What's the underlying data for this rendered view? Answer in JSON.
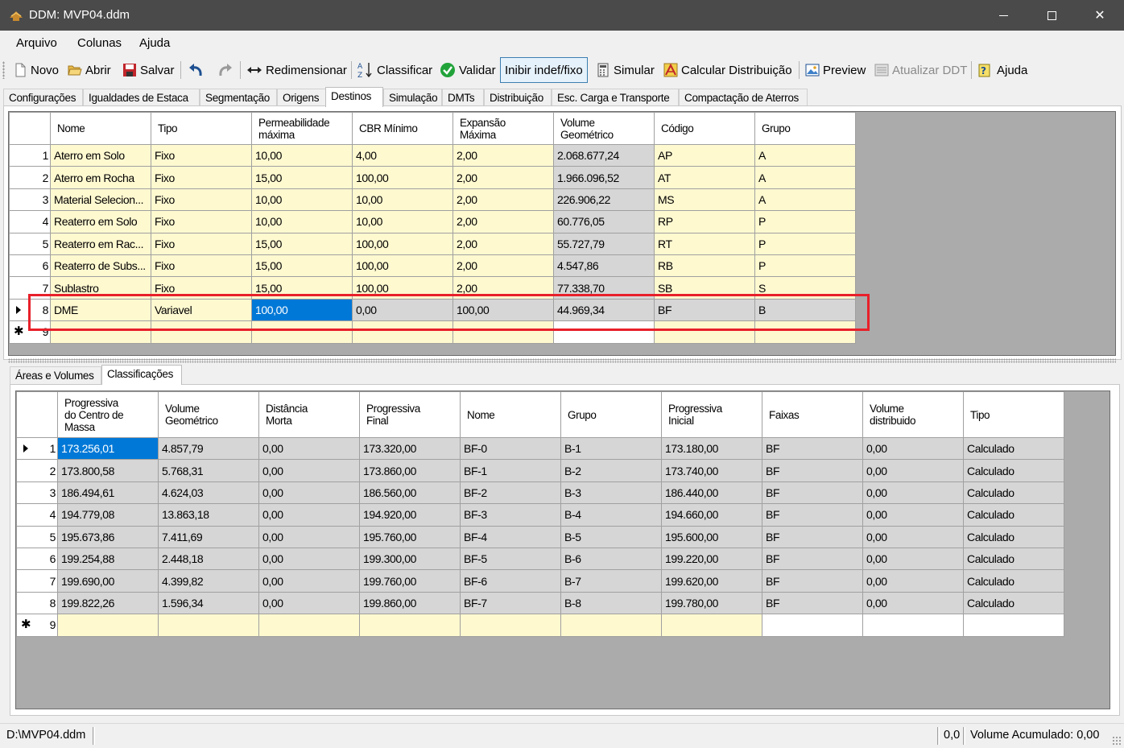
{
  "window": {
    "title": "DDM: MVP04.ddm",
    "minimize_icon": "minimize-icon",
    "maximize_icon": "maximize-icon",
    "close_glyph": "✕"
  },
  "menu": [
    "Arquivo",
    "Colunas",
    "Ajuda"
  ],
  "toolbar": {
    "novo": "Novo",
    "abrir": "Abrir",
    "salvar": "Salvar",
    "redimensionar": "Redimensionar",
    "classificar": "Classificar",
    "validar": "Validar",
    "inibir": "Inibir indef/fixo",
    "simular": "Simular",
    "calcular": "Calcular Distribuição",
    "preview": "Preview",
    "atualizar": "Atualizar DDT",
    "ajuda": "Ajuda"
  },
  "tabs": [
    "Configurações",
    "Igualdades de Estaca",
    "Segmentação",
    "Origens",
    "Destinos",
    "Simulação",
    "DMTs",
    "Distribuição",
    "Esc. Carga e Transporte",
    "Compactação de Aterros"
  ],
  "active_tab": "Destinos",
  "destinos_grid": {
    "headers": [
      [
        "Nome"
      ],
      [
        "Tipo"
      ],
      [
        "Permeabilidade",
        "máxima"
      ],
      [
        "CBR Mínimo"
      ],
      [
        "Expansão",
        "Máxima"
      ],
      [
        "Volume",
        "Geométrico"
      ],
      [
        "Código"
      ],
      [
        "Grupo"
      ]
    ],
    "rows": [
      {
        "n": "1",
        "cells": [
          "Aterro em Solo",
          "Fixo",
          "10,00",
          "4,00",
          "2,00",
          "2.068.677,24",
          "AP",
          "A"
        ]
      },
      {
        "n": "2",
        "cells": [
          "Aterro em Rocha",
          "Fixo",
          "15,00",
          "100,00",
          "2,00",
          "1.966.096,52",
          "AT",
          "A"
        ]
      },
      {
        "n": "3",
        "cells": [
          "Material Selecion...",
          "Fixo",
          "10,00",
          "10,00",
          "2,00",
          "226.906,22",
          "MS",
          "A"
        ]
      },
      {
        "n": "4",
        "cells": [
          "Reaterro em Solo",
          "Fixo",
          "10,00",
          "10,00",
          "2,00",
          "60.776,05",
          "RP",
          "P"
        ]
      },
      {
        "n": "5",
        "cells": [
          "Reaterro em Rac...",
          "Fixo",
          "15,00",
          "100,00",
          "2,00",
          "55.727,79",
          "RT",
          "P"
        ]
      },
      {
        "n": "6",
        "cells": [
          "Reaterro de Subs...",
          "Fixo",
          "15,00",
          "100,00",
          "2,00",
          "4.547,86",
          "RB",
          "P"
        ]
      },
      {
        "n": "7",
        "cells": [
          "Sublastro",
          "Fixo",
          "15,00",
          "100,00",
          "2,00",
          "77.338,70",
          "SB",
          "S"
        ]
      },
      {
        "n": "8",
        "cells": [
          "DME",
          "Variavel",
          "100,00",
          "0,00",
          "100,00",
          "44.969,34",
          "BF",
          "B"
        ]
      },
      {
        "n": "9",
        "cells": [
          "",
          "",
          "",
          "",
          "",
          "",
          "",
          ""
        ]
      }
    ]
  },
  "sub_tabs": [
    "Áreas e Volumes",
    "Classificações"
  ],
  "active_sub_tab": "Classificações",
  "classificacoes_grid": {
    "headers": [
      [
        "Progressiva",
        "do Centro de",
        "Massa"
      ],
      [
        "Volume",
        "Geométrico"
      ],
      [
        "Distância",
        "Morta"
      ],
      [
        "Progressiva",
        "Final"
      ],
      [
        "Nome"
      ],
      [
        "Grupo"
      ],
      [
        "Progressiva",
        "Inicial"
      ],
      [
        "Faixas"
      ],
      [
        "Volume",
        "distribuido"
      ],
      [
        "Tipo"
      ]
    ],
    "rows": [
      {
        "n": "1",
        "cells": [
          "173.256,01",
          "4.857,79",
          "0,00",
          "173.320,00",
          "BF-0",
          "B-1",
          "173.180,00",
          "BF",
          "0,00",
          "Calculado"
        ]
      },
      {
        "n": "2",
        "cells": [
          "173.800,58",
          "5.768,31",
          "0,00",
          "173.860,00",
          "BF-1",
          "B-2",
          "173.740,00",
          "BF",
          "0,00",
          "Calculado"
        ]
      },
      {
        "n": "3",
        "cells": [
          "186.494,61",
          "4.624,03",
          "0,00",
          "186.560,00",
          "BF-2",
          "B-3",
          "186.440,00",
          "BF",
          "0,00",
          "Calculado"
        ]
      },
      {
        "n": "4",
        "cells": [
          "194.779,08",
          "13.863,18",
          "0,00",
          "194.920,00",
          "BF-3",
          "B-4",
          "194.660,00",
          "BF",
          "0,00",
          "Calculado"
        ]
      },
      {
        "n": "5",
        "cells": [
          "195.673,86",
          "7.411,69",
          "0,00",
          "195.760,00",
          "BF-4",
          "B-5",
          "195.600,00",
          "BF",
          "0,00",
          "Calculado"
        ]
      },
      {
        "n": "6",
        "cells": [
          "199.254,88",
          "2.448,18",
          "0,00",
          "199.300,00",
          "BF-5",
          "B-6",
          "199.220,00",
          "BF",
          "0,00",
          "Calculado"
        ]
      },
      {
        "n": "7",
        "cells": [
          "199.690,00",
          "4.399,82",
          "0,00",
          "199.760,00",
          "BF-6",
          "B-7",
          "199.620,00",
          "BF",
          "0,00",
          "Calculado"
        ]
      },
      {
        "n": "8",
        "cells": [
          "199.822,26",
          "1.596,34",
          "0,00",
          "199.860,00",
          "BF-7",
          "B-8",
          "199.780,00",
          "BF",
          "0,00",
          "Calculado"
        ]
      },
      {
        "n": "9",
        "cells": [
          "",
          "",
          "",
          "",
          "",
          "",
          "",
          "",
          "",
          ""
        ]
      }
    ]
  },
  "status": {
    "file": "D:\\MVP04.ddm",
    "value": "0,0",
    "volume": "Volume Acumulado: 0,00"
  }
}
